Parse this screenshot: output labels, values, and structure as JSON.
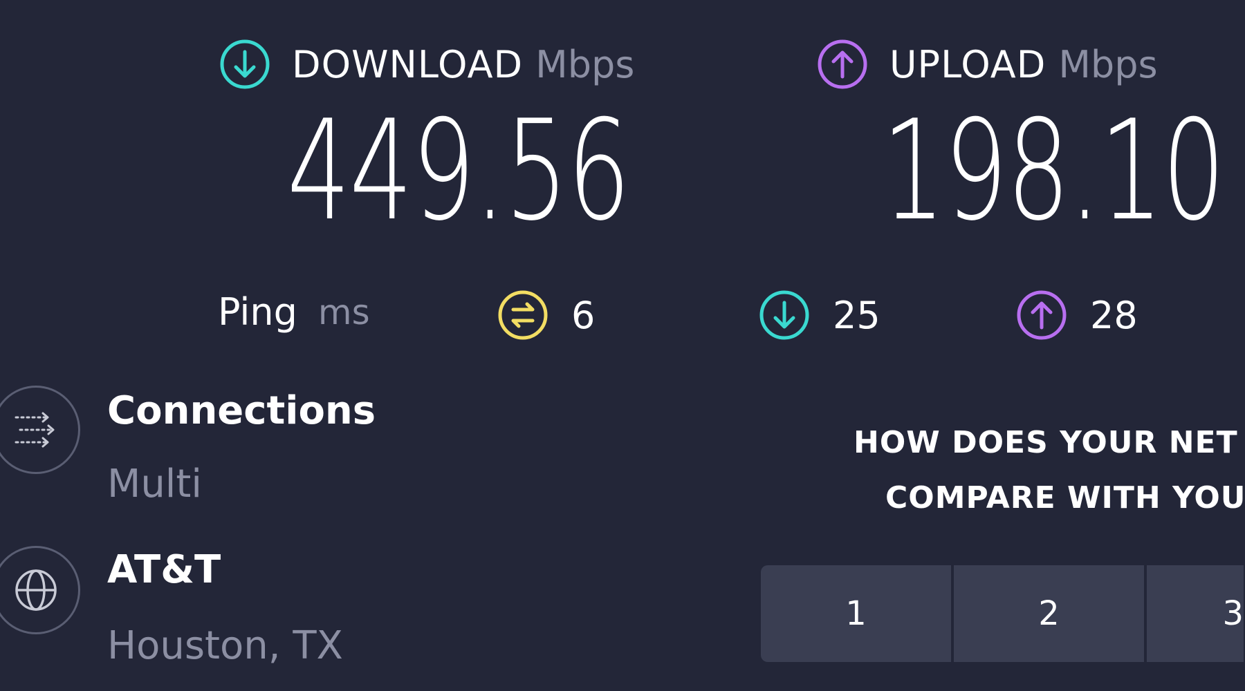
{
  "download": {
    "label": "DOWNLOAD",
    "unit": "Mbps",
    "value": "449.56",
    "color": "#3ad9d0"
  },
  "upload": {
    "label": "UPLOAD",
    "unit": "Mbps",
    "value": "198.10",
    "color": "#b86ff0"
  },
  "ping": {
    "label": "Ping",
    "unit": "ms",
    "idle": {
      "icon": "idle-latency-icon",
      "value": "6",
      "color": "#f2dd63"
    },
    "download": {
      "icon": "download-latency-icon",
      "value": "25",
      "color": "#3ad9d0"
    },
    "upload": {
      "icon": "upload-latency-icon",
      "value": "28",
      "color": "#b86ff0"
    }
  },
  "connections": {
    "title": "Connections",
    "value": "Multi",
    "icon": "connections-icon"
  },
  "provider": {
    "title": "AT&T",
    "location": "Houston, TX",
    "icon": "globe-icon"
  },
  "compare": {
    "line1": "HOW DOES YOUR NET",
    "line2": "COMPARE WITH YOU",
    "ratings": [
      "1",
      "2",
      "3"
    ]
  }
}
